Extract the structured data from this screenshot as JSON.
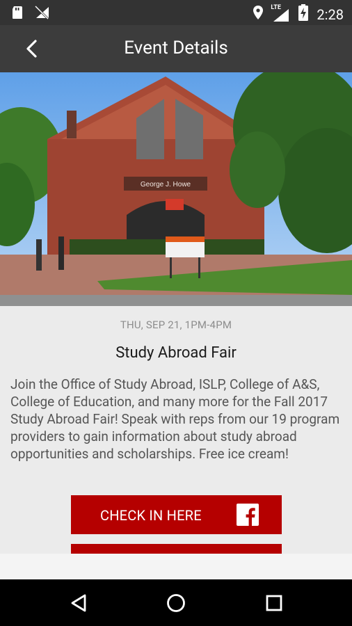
{
  "status_bar": {
    "time": "2:28",
    "network_label": "LTE",
    "icons": [
      "sd-card-icon",
      "no-signal-icon",
      "location-icon",
      "lte-signal-icon",
      "battery-charging-icon"
    ]
  },
  "app_bar": {
    "title": "Event Details",
    "back_icon": "back-arrow-icon"
  },
  "hero_image": {
    "subject": "red-brick-building-photo"
  },
  "event": {
    "date": "THU, SEP 21, 1PM-4PM",
    "name": "Study Abroad Fair",
    "description": "Join the Office of Study Abroad, ISLP, College of A&S, College of Education, and many more for the Fall 2017 Study Abroad Fair! Speak with reps from our 19 program providers to gain information about study abroad opportunities and scholarships. Free ice cream!"
  },
  "actions": {
    "checkin_label": "CHECK IN HERE",
    "checkin_icon": "facebook-icon"
  },
  "colors": {
    "accent": "#b50000",
    "status_bar": "#333333",
    "app_bar": "#3c3c3c",
    "background": "#ebebeb"
  },
  "nav_bar": {
    "items": [
      "back-nav-icon",
      "home-nav-icon",
      "recents-nav-icon"
    ]
  }
}
